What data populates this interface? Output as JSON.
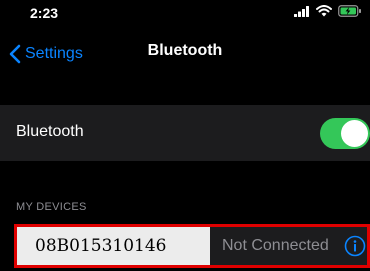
{
  "status_bar": {
    "time": "2:23",
    "icons": [
      "cellular-signal-icon",
      "wifi-icon",
      "battery-charging-icon"
    ]
  },
  "nav": {
    "back_label": "Settings",
    "title": "Bluetooth"
  },
  "bluetooth_row": {
    "label": "Bluetooth",
    "toggle_on": true
  },
  "my_devices": {
    "header": "MY DEVICES",
    "devices": [
      {
        "name": "08B015310146",
        "status": "Not Connected",
        "icon": "info-icon"
      }
    ]
  },
  "colors": {
    "accent": "#0a84ff",
    "toggle_on": "#34c759",
    "highlight_border": "#e00000",
    "background": "#000000",
    "cell": "#1c1c1e",
    "secondary_text": "#8e8e93"
  }
}
